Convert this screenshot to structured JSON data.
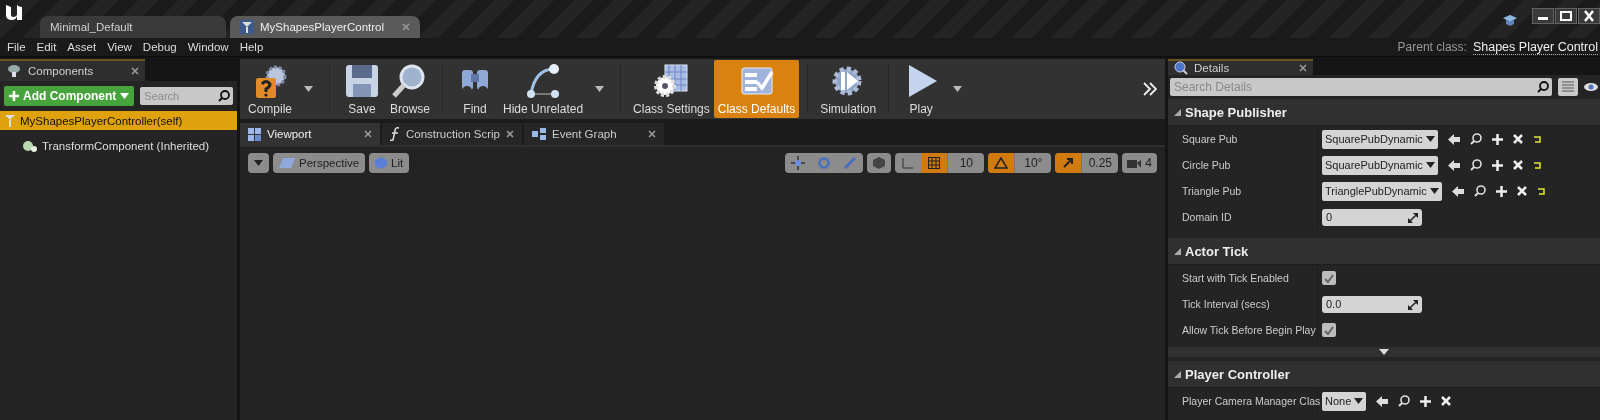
{
  "window": {
    "tabs": [
      {
        "label": "Minimal_Default",
        "selected": false
      },
      {
        "label": "MyShapesPlayerControl",
        "selected": true
      }
    ]
  },
  "menu": [
    "File",
    "Edit",
    "Asset",
    "View",
    "Debug",
    "Window",
    "Help"
  ],
  "parent_class": {
    "label": "Parent class:",
    "value": "Shapes Player Control"
  },
  "components": {
    "title": "Components",
    "add_button": "Add Component",
    "search": {
      "placeholder": "Search"
    },
    "tree": [
      {
        "label": "MyShapesPlayerController(self)",
        "selected": true,
        "children": [
          {
            "label": "TransformComponent (Inherited)",
            "selected": false
          }
        ]
      }
    ]
  },
  "toolbar": [
    {
      "items": [
        {
          "kind": "compile",
          "label": "Compile",
          "dropdown": true,
          "selected": false
        }
      ]
    },
    {
      "items": [
        {
          "kind": "save",
          "label": "Save",
          "dropdown": false,
          "selected": false
        },
        {
          "kind": "browse",
          "label": "Browse",
          "dropdown": false,
          "selected": false
        }
      ]
    },
    {
      "items": [
        {
          "kind": "find",
          "label": "Find",
          "dropdown": false,
          "selected": false
        },
        {
          "kind": "hide",
          "label": "Hide Unrelated",
          "dropdown": true,
          "selected": false
        }
      ]
    },
    {
      "items": [
        {
          "kind": "settings",
          "label": "Class Settings",
          "dropdown": false,
          "selected": false
        },
        {
          "kind": "defaults",
          "label": "Class Defaults",
          "dropdown": false,
          "selected": true
        }
      ]
    },
    {
      "items": [
        {
          "kind": "simulation",
          "label": "Simulation",
          "dropdown": false,
          "selected": false
        }
      ]
    },
    {
      "items": [
        {
          "kind": "play",
          "label": "Play",
          "dropdown": true,
          "selected": false
        }
      ]
    }
  ],
  "editor_tabs": [
    {
      "kind": "viewport",
      "label": "Viewport",
      "selected": true
    },
    {
      "kind": "function",
      "label": "Construction Scrip",
      "selected": false
    },
    {
      "kind": "graph",
      "label": "Event Graph",
      "selected": false
    }
  ],
  "viewport": {
    "view_mode": "Perspective",
    "lighting": "Lit",
    "snaps": [
      {
        "kind": "grid",
        "value": "10",
        "on": true
      },
      {
        "kind": "rotation",
        "value": "10°",
        "on": true
      },
      {
        "kind": "scale",
        "value": "0.25",
        "on": true
      }
    ],
    "camera_speed": "4"
  },
  "details": {
    "title": "Details",
    "search": {
      "placeholder": "Search Details"
    },
    "sections": [
      {
        "title": "Shape Publisher",
        "expanded": true,
        "advanced": false,
        "rows": [
          {
            "kind": "asset",
            "label": "Square Pub",
            "value": "SquarePubDynamic",
            "modified": true
          },
          {
            "kind": "asset",
            "label": "Circle Pub",
            "value": "SquarePubDynamic",
            "modified": true
          },
          {
            "kind": "asset",
            "label": "Triangle Pub",
            "value": "TrianglePubDynamic",
            "modified": true
          },
          {
            "kind": "number",
            "label": "Domain ID",
            "value": "0"
          }
        ]
      },
      {
        "title": "Actor Tick",
        "expanded": true,
        "advanced": true,
        "rows": [
          {
            "kind": "checkbox",
            "label": "Start with Tick Enabled",
            "checked": true
          },
          {
            "kind": "number",
            "label": "Tick Interval (secs)",
            "value": "0.0"
          },
          {
            "kind": "checkbox",
            "label": "Allow Tick Before Begin Play",
            "checked": true
          }
        ]
      },
      {
        "title": "Player Controller",
        "expanded": true,
        "advanced": false,
        "rows": [
          {
            "kind": "asset",
            "label": "Player Camera Manager Clas",
            "value": "None",
            "modified": false
          }
        ]
      }
    ]
  }
}
